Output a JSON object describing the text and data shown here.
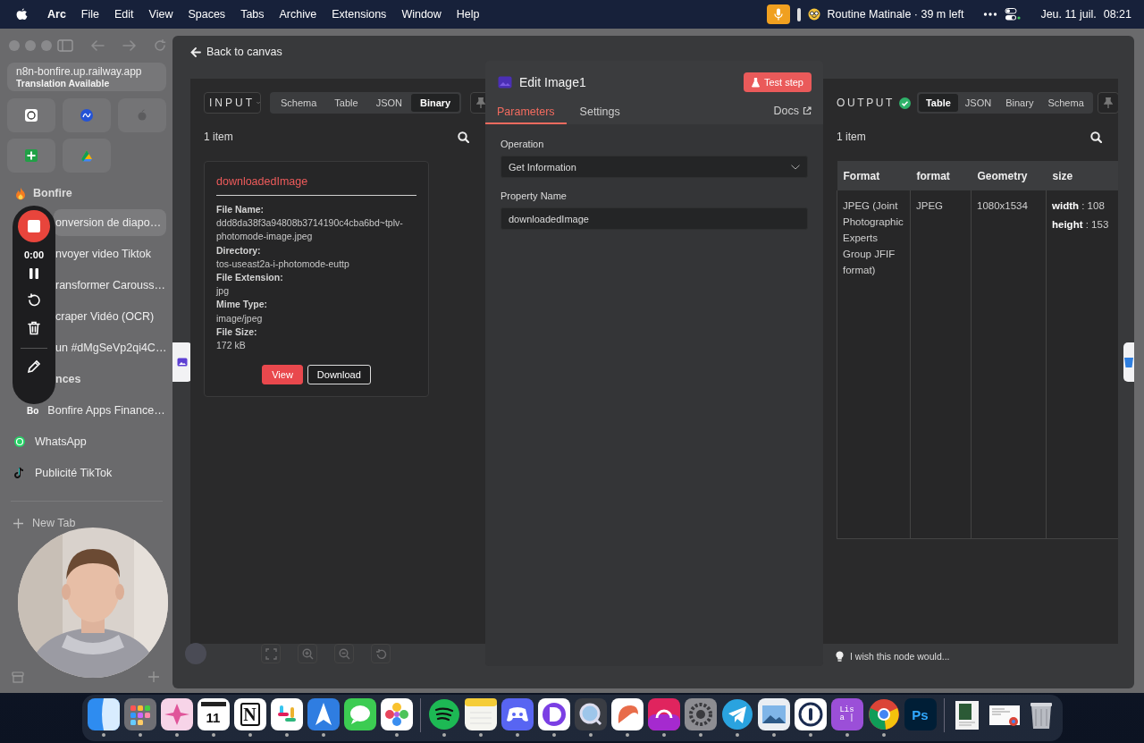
{
  "menu_bar": {
    "app": "Arc",
    "menus": [
      "File",
      "Edit",
      "View",
      "Spaces",
      "Tabs",
      "Archive",
      "Extensions",
      "Window",
      "Help"
    ],
    "focus_title": "Routine Matinale · 39 m left",
    "date": "Jeu. 11 juil.",
    "time": "08:21"
  },
  "sidebar": {
    "url": "n8n-bonfire.up.railway.app",
    "url_note": "Translation Available",
    "folders": [
      {
        "title": "Bonfire",
        "children": [
          {
            "title": "onversion de diapo…",
            "selected": true
          },
          {
            "title": "nvoyer video Tiktok",
            "selected": false
          },
          {
            "title": "ransformer Carouss…",
            "selected": false
          },
          {
            "title": "craper Vidéo (OCR)",
            "selected": false
          },
          {
            "title": "un #dMgSeVp2qi4C…",
            "selected": false
          }
        ]
      },
      {
        "title": "nces",
        "children": [
          {
            "title": "Bonfire Apps Finance…",
            "favicon": "Bo",
            "selected": false
          }
        ]
      }
    ],
    "tabs": [
      {
        "title": "WhatsApp",
        "selected": false
      },
      {
        "title": "Publicité TikTok",
        "selected": false
      }
    ],
    "new_tab": "New Tab"
  },
  "recorder": {
    "time": "0:00"
  },
  "n8n": {
    "back": "Back to canvas",
    "input": {
      "label": "INPUT",
      "views": [
        {
          "label": "Schema",
          "selected": false
        },
        {
          "label": "Table",
          "selected": false
        },
        {
          "label": "JSON",
          "selected": false
        },
        {
          "label": "Binary",
          "selected": true
        }
      ],
      "count": "1 item",
      "binary": {
        "name": "downloadedImage",
        "fields": [
          {
            "label": "File Name:",
            "value": "ddd8da38f3a94808b3714190c4cba6bd~tplv-photomode-image.jpeg"
          },
          {
            "label": "Directory:",
            "value": "tos-useast2a-i-photomode-euttp"
          },
          {
            "label": "File Extension:",
            "value": "jpg"
          },
          {
            "label": "Mime Type:",
            "value": "image/jpeg"
          },
          {
            "label": "File Size:",
            "value": "172 kB"
          }
        ],
        "buttons": [
          {
            "label": "View",
            "kind": "primary"
          },
          {
            "label": "Download",
            "kind": "secondary"
          }
        ]
      }
    },
    "editor": {
      "title": "Edit Image1",
      "test_button": "Test step",
      "tabs": [
        {
          "label": "Parameters",
          "selected": true
        },
        {
          "label": "Settings",
          "selected": false
        }
      ],
      "docs": "Docs",
      "params": [
        {
          "label": "Operation",
          "kind": "select",
          "value": "Get Information"
        },
        {
          "label": "Property Name",
          "kind": "text",
          "value": "downloadedImage"
        }
      ]
    },
    "output": {
      "label": "OUTPUT",
      "success": true,
      "views": [
        {
          "label": "Table",
          "selected": true
        },
        {
          "label": "JSON",
          "selected": false
        },
        {
          "label": "Binary",
          "selected": false
        },
        {
          "label": "Schema",
          "selected": false
        }
      ],
      "count": "1 item",
      "table": {
        "columns": [
          "Format",
          "format",
          "Geometry",
          "size"
        ],
        "rows": [
          [
            "JPEG (Joint Photographic Experts Group JFIF format)",
            "JPEG",
            "1080x1534",
            [
              "**width** : 108",
              "**height** : 153"
            ]
          ]
        ]
      }
    },
    "feedback": "I wish this node would..."
  },
  "dock": [
    {
      "running": true
    },
    {
      "running": true
    },
    {
      "running": true
    },
    {
      "running": true,
      "label": "11"
    },
    {
      "running": true,
      "label": "N"
    },
    {
      "running": true
    },
    {
      "running": true
    },
    {
      "running": false
    },
    {
      "running": true
    },
    {
      "running": true
    },
    {
      "running": true
    },
    {
      "running": true
    },
    {
      "running": true
    },
    {
      "running": true
    },
    {
      "running": true
    },
    {
      "running": true
    },
    {
      "running": true
    },
    {
      "running": true
    },
    {
      "running": true
    },
    {
      "running": true
    },
    {
      "running": true,
      "label": "Lis a |"
    },
    {
      "running": true
    },
    {
      "running": false,
      "label": "Ps"
    },
    {
      "running": false
    },
    {
      "running": false
    },
    {
      "running": false
    }
  ]
}
